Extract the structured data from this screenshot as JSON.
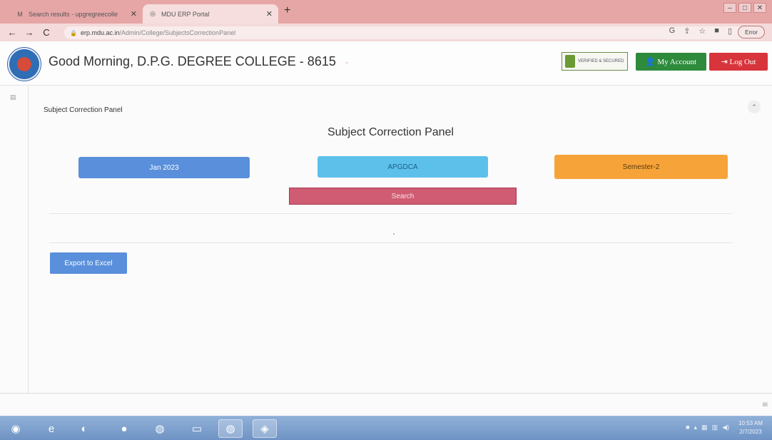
{
  "browser": {
    "tabs": [
      {
        "title": "Search results - upgregreecolle",
        "active": false
      },
      {
        "title": "MDU ERP Portal",
        "active": true
      }
    ],
    "url_host": "erp.mdu.ac.in",
    "url_path": "/Admin/College/SubjectsCorrectionPanel",
    "error_label": "Error"
  },
  "header": {
    "greeting": "Good Morning, D.P.G. DEGREE COLLEGE - 8615",
    "badge_text": "VERIFIED & SECURED",
    "my_account_label": "My Account",
    "logout_label": "Log Out"
  },
  "main": {
    "breadcrumb": "Subject Correction Panel",
    "title": "Subject Correction Panel",
    "session_value": "Jan 2023",
    "course_value": "APGDCA",
    "semester_value": "Semester-2",
    "search_label": "Search",
    "export_label": "Export to Excel"
  },
  "taskbar": {
    "time": "10:53 AM",
    "date": "2/7/2023"
  },
  "colors": {
    "tab_strip": "#e7a6a6",
    "session_button": "#5a8fdb",
    "course_button": "#5cc0ea",
    "semester_button": "#f6a43a",
    "search_button": "#cf5c72",
    "account_button": "#2e8b3c",
    "logout_button": "#d8343b"
  }
}
